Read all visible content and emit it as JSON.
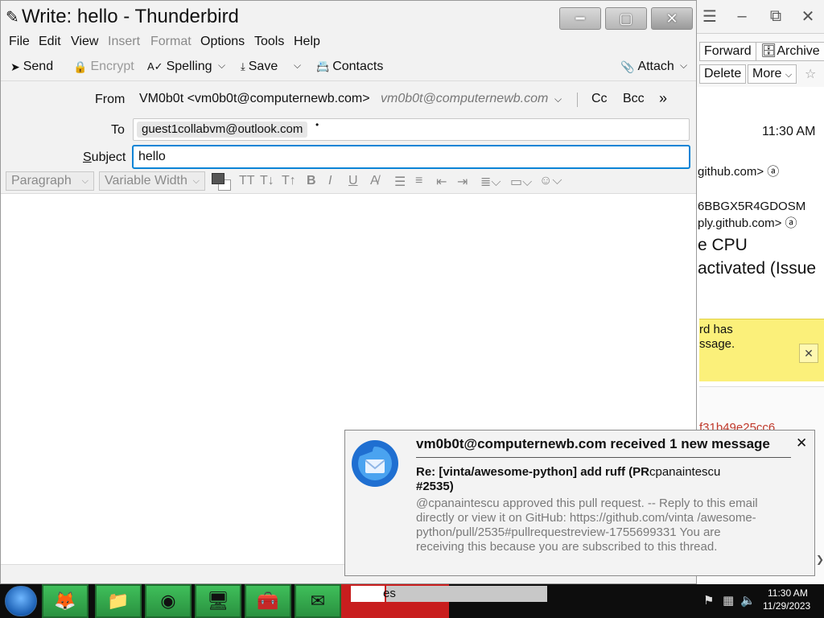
{
  "compose": {
    "title": "Write: hello - Thunderbird",
    "menu": [
      "File",
      "Edit",
      "View",
      "Insert",
      "Format",
      "Options",
      "Tools",
      "Help"
    ],
    "toolbar": {
      "send": "Send",
      "encrypt": "Encrypt",
      "spelling": "Spelling",
      "save": "Save",
      "contacts": "Contacts",
      "attach": "Attach"
    },
    "headers": {
      "from_label": "From",
      "from_value": "VM0b0t <vm0b0t@computernewb.com>",
      "from_identity": "vm0b0t@computernewb.com",
      "cc": "Cc",
      "bcc": "Bcc",
      "to_label": "To",
      "to_recipient": "guest1collabvm@outlook.com",
      "subject_label": "Subject",
      "subject_value": "hello"
    },
    "format_bar": {
      "paragraph": "Paragraph",
      "font": "Variable Width"
    }
  },
  "background_window": {
    "forward": "Forward",
    "archive": "Archive",
    "delete": "Delete",
    "more": "More",
    "time": "11:30 AM",
    "line1": "github.com> ⓐ",
    "line2": "6BBGX5R4GDOSM",
    "line3": "ply.github.com> ⓐ",
    "line4": "e CPU",
    "line5": "activated (Issue",
    "notice_line1": "rd has",
    "notice_line2": "ssage.",
    "hash": "f31b49e25cc6"
  },
  "notification": {
    "title": "vm0b0t@computernewb.com received 1 new message",
    "subject": "Re: [vinta/awesome-python] add ruff (PR #2535)",
    "sender": "cpanaintescu",
    "preview": "@cpanaintescu approved this pull request. -- Reply to this email directly or view it on GitHub: https://github.com/vinta /awesome-python/pull/2535#pullrequestreview-1755699331 You are receiving this because you are subscribed to this thread."
  },
  "taskbar": {
    "clock_time": "11:30 AM",
    "clock_date": "11/29/2023",
    "label_fragment": "es"
  },
  "colors": {
    "focus_blue": "#0a84d6",
    "notice_yellow": "#fbf07a",
    "taskbar_green": "#3fbf5a",
    "taskbar_red": "#c81e1e"
  }
}
